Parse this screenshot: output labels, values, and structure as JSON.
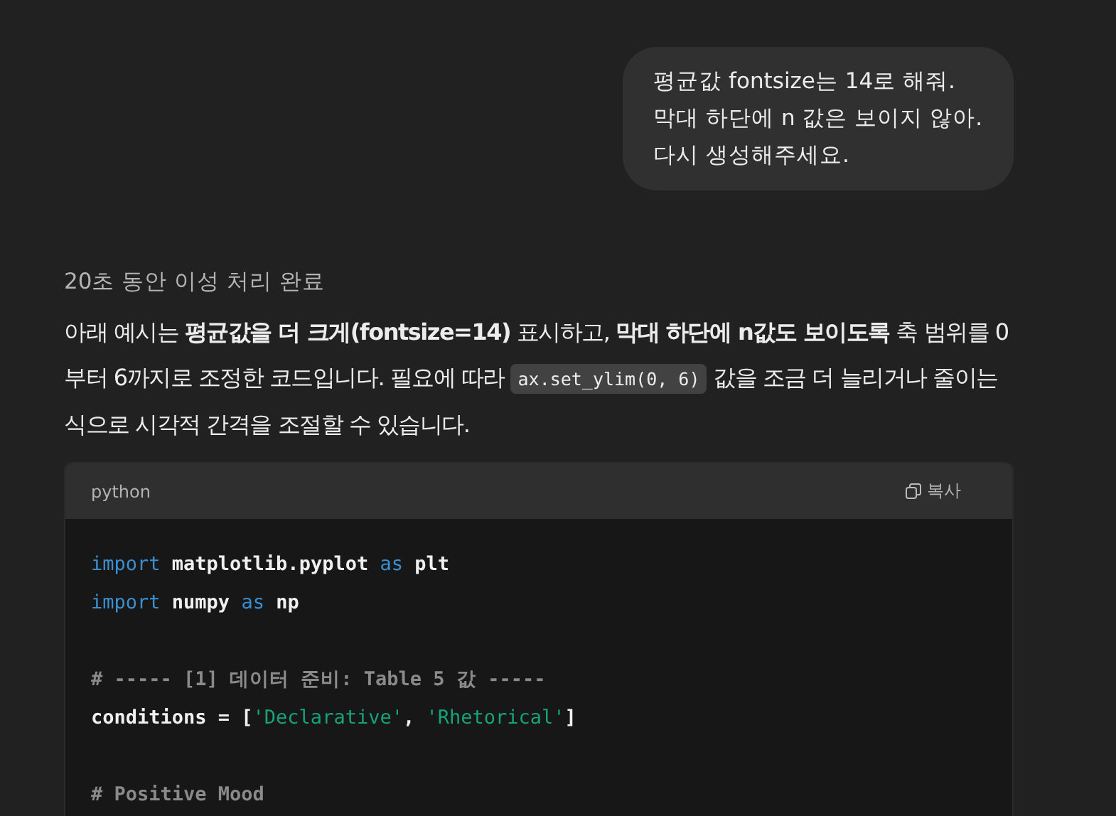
{
  "user_message": {
    "lines": [
      "평균값 fontsize는 14로 해줘.",
      "막대 하단에 n 값은 보이지 않아.",
      "다시 생성해주세요."
    ]
  },
  "reasoning_label": "20초 동안 이성 처리 완료",
  "answer": {
    "parts": [
      {
        "kind": "text",
        "text": "아래 예시는 **평균값을 더 크게(fontsize=14)** 표시하고, **막대 하단에 n값도 보이도록** 축 범위를 0부터 6까지로 조정한 코드입니다. 필요에 따라 "
      },
      {
        "kind": "code",
        "text": "ax.set_ylim(0, 6)"
      },
      {
        "kind": "text",
        "text": " 값을 조금 더 늘리거나 줄이는 식으로 시각적 간격을 조절할 수 있습니다."
      }
    ]
  },
  "code_block": {
    "language": "python",
    "copy_label": "복사",
    "lines": [
      {
        "kind": "code",
        "tokens": [
          {
            "kind": "keyword",
            "text": "import"
          },
          {
            "kind": "plain",
            "text": " matplotlib.pyplot "
          },
          {
            "kind": "keyword",
            "text": "as"
          },
          {
            "kind": "plain",
            "text": " plt"
          }
        ]
      },
      {
        "kind": "code",
        "tokens": [
          {
            "kind": "keyword",
            "text": "import"
          },
          {
            "kind": "plain",
            "text": " numpy "
          },
          {
            "kind": "keyword",
            "text": "as"
          },
          {
            "kind": "plain",
            "text": " np"
          }
        ]
      },
      {
        "kind": "blank"
      },
      {
        "kind": "code",
        "tokens": [
          {
            "kind": "comment",
            "text": "# ----- [1] 데이터 준비: Table 5 값 -----"
          }
        ]
      },
      {
        "kind": "code",
        "tokens": [
          {
            "kind": "plain",
            "text": "conditions = ["
          },
          {
            "kind": "string",
            "text": "'Declarative'"
          },
          {
            "kind": "plain",
            "text": ", "
          },
          {
            "kind": "string",
            "text": "'Rhetorical'"
          },
          {
            "kind": "plain",
            "text": "]"
          }
        ]
      },
      {
        "kind": "blank"
      },
      {
        "kind": "code",
        "tokens": [
          {
            "kind": "comment",
            "text": "# Positive Mood"
          }
        ]
      }
    ]
  }
}
